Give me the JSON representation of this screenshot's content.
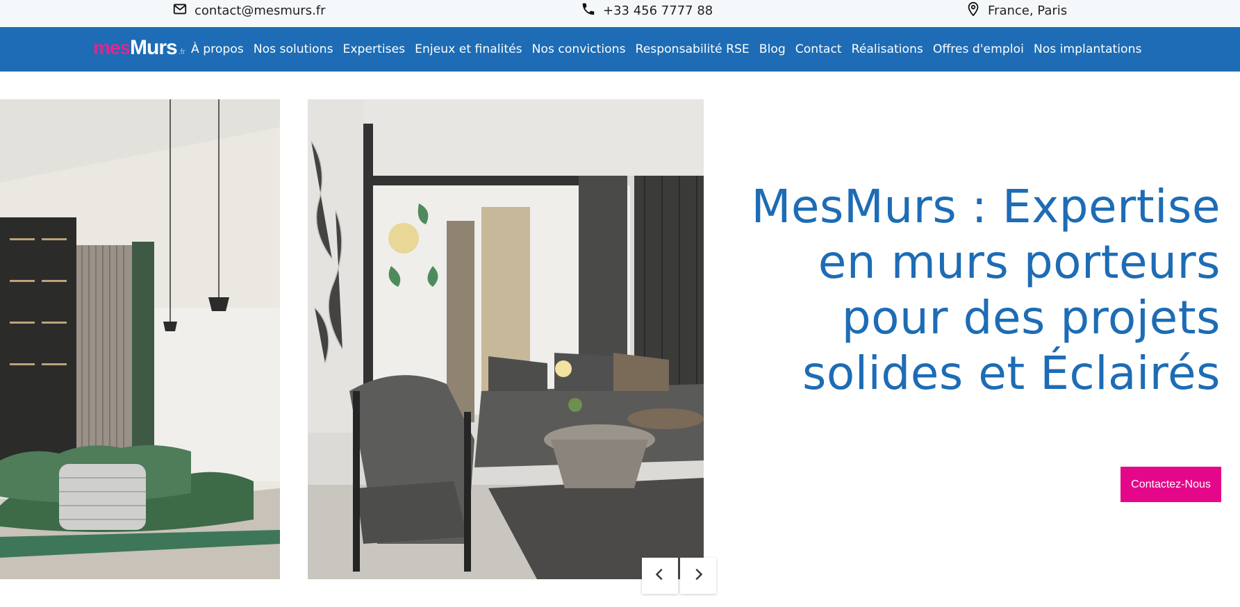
{
  "topbar": {
    "email": "contact@mesmurs.fr",
    "phone": "+33 456 7777 88",
    "location": "France, Paris"
  },
  "nav": {
    "logo": {
      "part1": "mes",
      "part2": "Murs",
      "tld": ".fr"
    },
    "links": [
      "À propos",
      "Nos solutions",
      "Expertises",
      "Enjeux et finalités",
      "Nos convictions",
      "Responsabilité RSE",
      "Blog",
      "Contact",
      "Réalisations",
      "Offres d'emploi",
      "Nos implantations"
    ]
  },
  "hero": {
    "title_lines": [
      "MesMurs : Expertise",
      "en murs porteurs",
      "pour des projets",
      "solides et Éclairés"
    ],
    "cta_label": "Contactez-Nous"
  },
  "colors": {
    "brand_blue": "#1d6cb5",
    "brand_pink": "#e5078a",
    "topbar_bg": "#f4f8fb"
  },
  "icons": {
    "email": "mail-icon",
    "phone": "phone-icon",
    "location": "map-pin-icon",
    "prev": "chevron-left-icon",
    "next": "chevron-right-icon"
  }
}
